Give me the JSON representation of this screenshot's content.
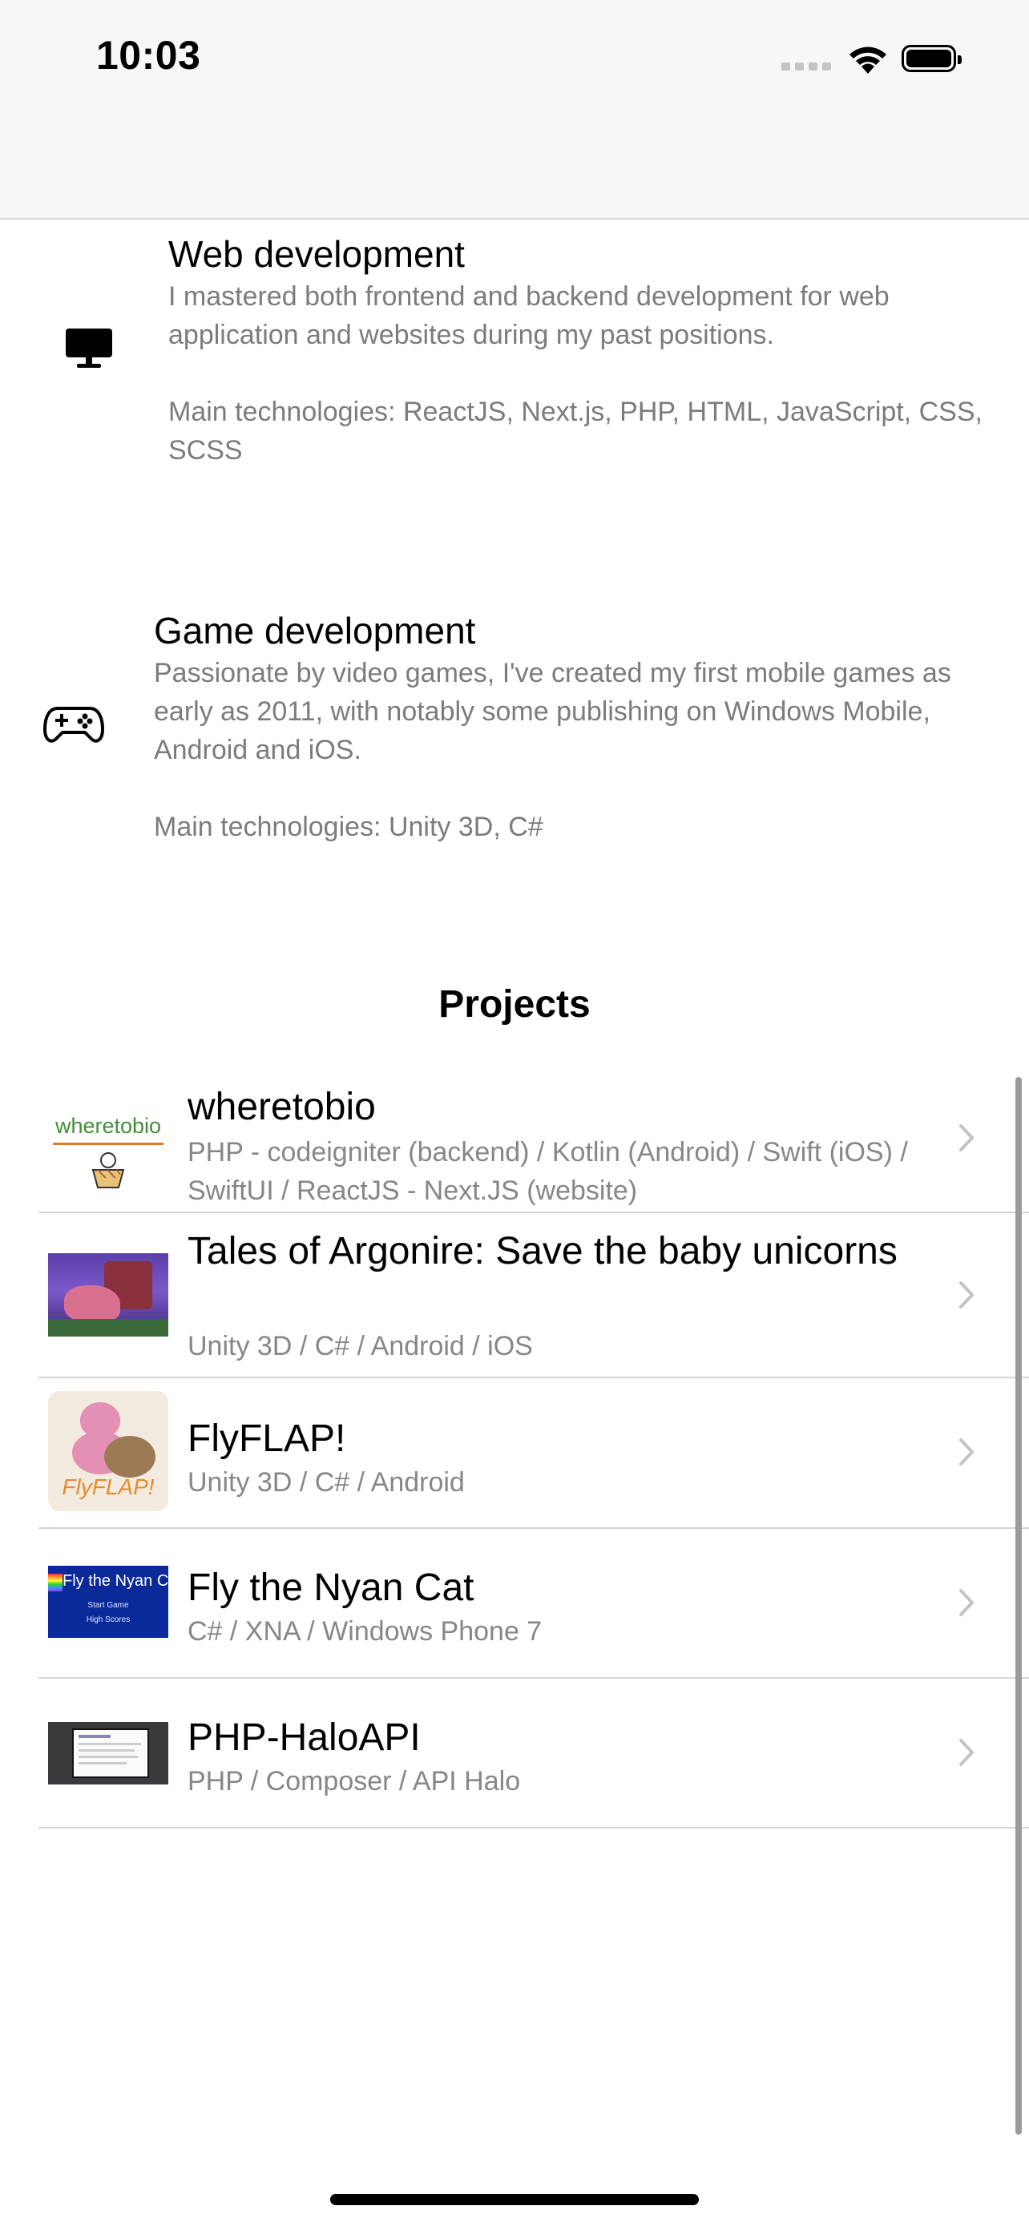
{
  "status_bar": {
    "time": "10:03"
  },
  "skills": [
    {
      "icon": "desktop-icon",
      "title": "Web development",
      "description": "I mastered both frontend and backend development for web application and websites during my past positions.",
      "technologies": "Main technologies: ReactJS, Next.js, PHP, HTML, JavaScript, CSS, SCSS"
    },
    {
      "icon": "gamepad-icon",
      "title": "Game development",
      "description": "Passionate by video games, I've created my first mobile games as early as 2011, with notably some publishing on Windows Mobile, Android and iOS.",
      "technologies": "Main technologies: Unity 3D, C#"
    }
  ],
  "projects_title": "Projects",
  "projects": [
    {
      "title": "wheretobio",
      "subtitle": "PHP - codeigniter (backend) / Kotlin (Android) / Swift (iOS) / SwiftUI / ReactJS - Next.JS (website)",
      "thumbnail_text": "wheretobio"
    },
    {
      "title": "Tales of Argonire: Save the baby unicorns",
      "subtitle": "Unity 3D / C# / Android / iOS"
    },
    {
      "title": "FlyFLAP!",
      "subtitle": "Unity 3D / C# / Android",
      "thumbnail_text": "FlyFLAP!"
    },
    {
      "title": "Fly the Nyan Cat",
      "subtitle": "C# / XNA / Windows Phone 7",
      "thumbnail_text": "Fly the Nyan Cat",
      "thumbnail_menu": [
        "Start Game",
        "High Scores"
      ]
    },
    {
      "title": "PHP-HaloAPI",
      "subtitle": "PHP / Composer / API Halo"
    }
  ],
  "colors": {
    "secondary_text": "#7b7b80",
    "separator": "#d6d6d9",
    "chevron": "#c4c4c7"
  }
}
